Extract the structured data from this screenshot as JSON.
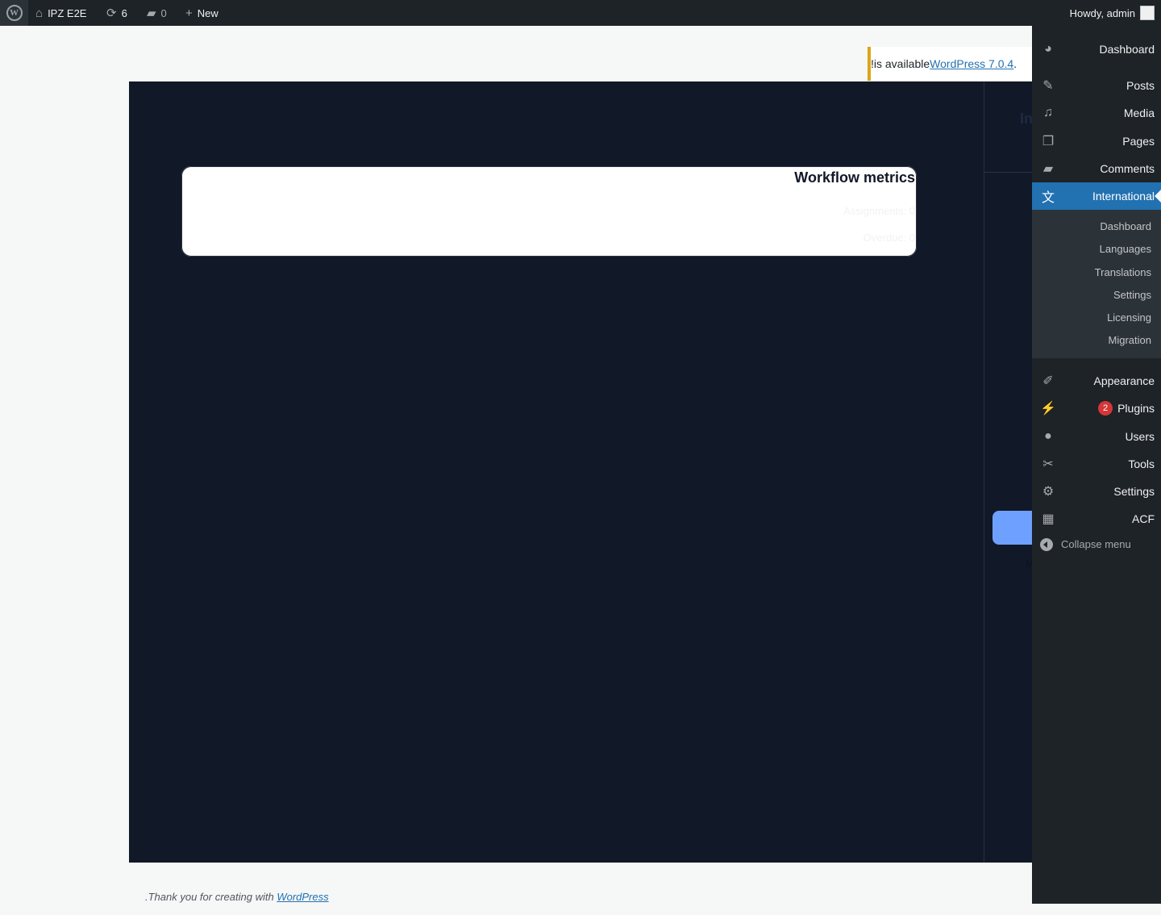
{
  "adminbar": {
    "wp_logo": "wordpress-logo",
    "site_name": "IPZ E2E",
    "updates_count": "6",
    "comments_count": "0",
    "new_label": "New",
    "howdy": "Howdy, admin"
  },
  "notice": {
    "link_text": "WordPress 7.0.4",
    "suffix": " is available!",
    "prefix": "."
  },
  "app": {
    "card": {
      "title": "Workflow metrics",
      "assignments": "Assignments: 0",
      "overdue": "Overdue: 0"
    },
    "side_title": "In",
    "side_label": "M"
  },
  "menu": {
    "items": [
      {
        "label": "Dashboard",
        "icon": "dashboard-icon"
      },
      {
        "label": "Posts",
        "icon": "pin-icon"
      },
      {
        "label": "Media",
        "icon": "media-icon"
      },
      {
        "label": "Pages",
        "icon": "pages-icon"
      },
      {
        "label": "Comments",
        "icon": "comments-icon"
      },
      {
        "label": "International",
        "icon": "translation-icon"
      },
      {
        "label": "Appearance",
        "icon": "brush-icon"
      },
      {
        "label": "Plugins",
        "icon": "plugin-icon",
        "badge": "2"
      },
      {
        "label": "Users",
        "icon": "users-icon"
      },
      {
        "label": "Tools",
        "icon": "wrench-icon"
      },
      {
        "label": "Settings",
        "icon": "settings-icon"
      },
      {
        "label": "ACF",
        "icon": "acf-icon"
      }
    ],
    "submenu": [
      "Dashboard",
      "Languages",
      "Translations",
      "Settings",
      "Licensing",
      "Migration"
    ],
    "collapse": "Collapse menu"
  },
  "footer": {
    "prefix": ".Thank you for creating with ",
    "link": "WordPress"
  },
  "colors": {
    "adminbar_bg": "#1d2327",
    "accent": "#2271b1",
    "notice_border": "#dba617",
    "app_bg": "#111827",
    "badge": "#d63638"
  }
}
